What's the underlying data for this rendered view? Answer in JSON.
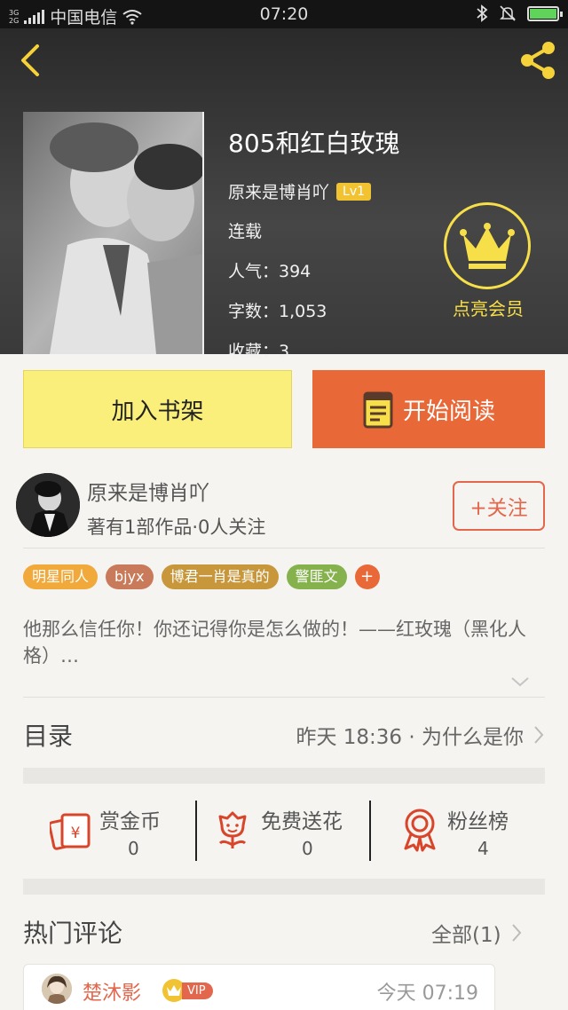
{
  "status_bar": {
    "network": "3G\n2G",
    "carrier": "中国电信",
    "time": "07:20"
  },
  "book": {
    "title": "805和红白玫瑰",
    "author": "原来是博肖吖",
    "level": "Lv1",
    "status": "连载",
    "popularity": "人气：394",
    "word_count": "字数：1,053",
    "favorites": "收藏：3"
  },
  "vip_promo": {
    "label": "点亮会员"
  },
  "actions": {
    "add_shelf": "加入书架",
    "start_read": "开始阅读"
  },
  "author_card": {
    "name": "原来是博肖吖",
    "stats": "著有1部作品·0人关注",
    "follow": "+关注"
  },
  "tags": [
    {
      "label": "明星同人",
      "color": "#f0a93a"
    },
    {
      "label": "bjyx",
      "color": "#c97a5a"
    },
    {
      "label": "博君一肖是真的",
      "color": "#c8973c"
    },
    {
      "label": "警匪文",
      "color": "#86b24e"
    }
  ],
  "tag_more": "+",
  "description": "他那么信任你！你还记得你是怎么做的！——红玫瑰（黑化人格）…",
  "toc": {
    "title": "目录",
    "latest": "昨天 18:36 · 为什么是你"
  },
  "stats": [
    {
      "label": "赏金币",
      "value": "0",
      "icon": "red-envelope-icon"
    },
    {
      "label": "免费送花",
      "value": "0",
      "icon": "flower-icon"
    },
    {
      "label": "粉丝榜",
      "value": "4",
      "icon": "medal-icon"
    }
  ],
  "comments": {
    "title": "热门评论",
    "all_link": "全部(1)",
    "items": [
      {
        "user": "楚沐影",
        "vip": "VIP",
        "time": "今天 07:19"
      }
    ]
  },
  "colors": {
    "accent_orange": "#e96838",
    "shelf_yellow": "#fbef7c",
    "vip_gold": "#f7df4a"
  }
}
